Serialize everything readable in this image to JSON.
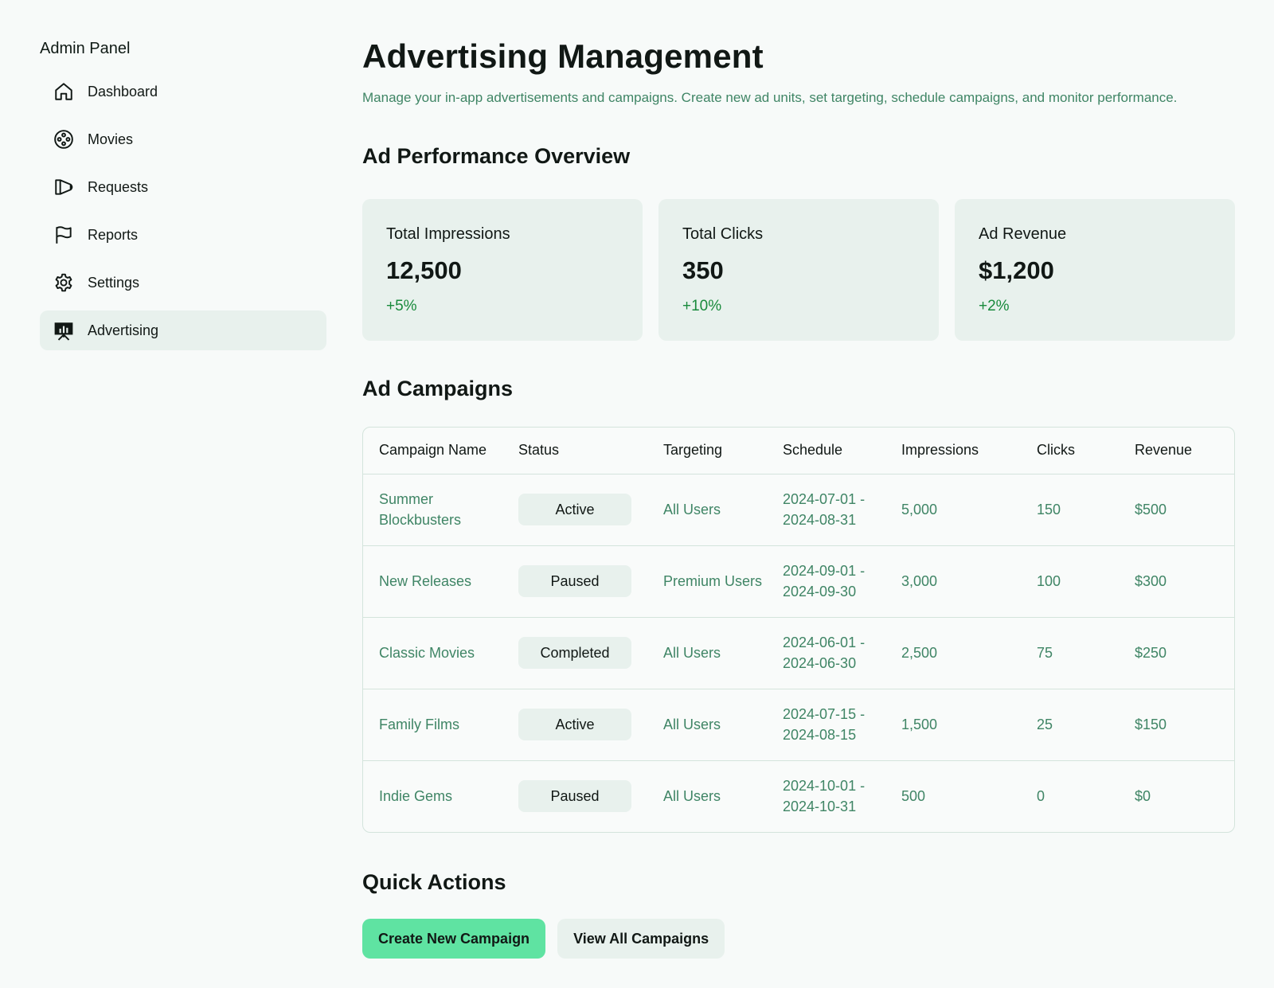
{
  "sidebar": {
    "title": "Admin Panel",
    "items": [
      {
        "label": "Dashboard",
        "icon": "house-icon",
        "active": false
      },
      {
        "label": "Movies",
        "icon": "film-reel-icon",
        "active": false
      },
      {
        "label": "Requests",
        "icon": "megaphone-icon",
        "active": false
      },
      {
        "label": "Reports",
        "icon": "flag-icon",
        "active": false
      },
      {
        "label": "Settings",
        "icon": "gear-icon",
        "active": false
      },
      {
        "label": "Advertising",
        "icon": "presentation-chart-icon",
        "active": true
      }
    ]
  },
  "header": {
    "title": "Advertising Management",
    "subtitle": "Manage your in-app advertisements and campaigns. Create new ad units, set targeting, schedule campaigns, and monitor performance."
  },
  "performance": {
    "title": "Ad Performance Overview",
    "cards": [
      {
        "label": "Total Impressions",
        "value": "12,500",
        "change": "+5%"
      },
      {
        "label": "Total Clicks",
        "value": "350",
        "change": "+10%"
      },
      {
        "label": "Ad Revenue",
        "value": "$1,200",
        "change": "+2%"
      }
    ]
  },
  "campaigns": {
    "title": "Ad Campaigns",
    "columns": [
      "Campaign Name",
      "Status",
      "Targeting",
      "Schedule",
      "Impressions",
      "Clicks",
      "Revenue"
    ],
    "rows": [
      {
        "name": "Summer Blockbusters",
        "status": "Active",
        "targeting": "All Users",
        "schedule": "2024-07-01 - 2024-08-31",
        "impressions": "5,000",
        "clicks": "150",
        "revenue": "$500"
      },
      {
        "name": "New Releases",
        "status": "Paused",
        "targeting": "Premium Users",
        "schedule": "2024-09-01 - 2024-09-30",
        "impressions": "3,000",
        "clicks": "100",
        "revenue": "$300"
      },
      {
        "name": "Classic Movies",
        "status": "Completed",
        "targeting": "All Users",
        "schedule": "2024-06-01 - 2024-06-30",
        "impressions": "2,500",
        "clicks": "75",
        "revenue": "$250"
      },
      {
        "name": "Family Films",
        "status": "Active",
        "targeting": "All Users",
        "schedule": "2024-07-15 - 2024-08-15",
        "impressions": "1,500",
        "clicks": "25",
        "revenue": "$150"
      },
      {
        "name": "Indie Gems",
        "status": "Paused",
        "targeting": "All Users",
        "schedule": "2024-10-01 - 2024-10-31",
        "impressions": "500",
        "clicks": "0",
        "revenue": "$0"
      }
    ]
  },
  "quick_actions": {
    "title": "Quick Actions",
    "create_label": "Create New Campaign",
    "view_all_label": "View All Campaigns"
  },
  "colors": {
    "background": "#f7faf9",
    "card": "#e8f1ed",
    "accent_text": "#3f8565",
    "positive_change": "#198a3c",
    "primary_button": "#5fe3a2"
  }
}
